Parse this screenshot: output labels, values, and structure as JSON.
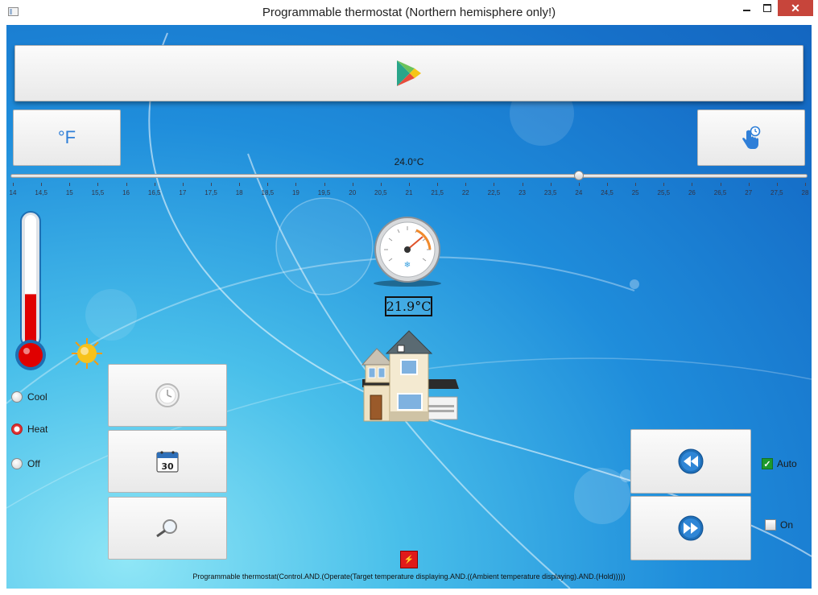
{
  "window": {
    "title": "Programmable thermostat (Northern hemisphere only!)",
    "close_glyph": "✕"
  },
  "toolbar": {
    "play_icon": "play-store-icon",
    "unit_label": "°F",
    "touch_icon": "touch-timer-icon"
  },
  "slider": {
    "value_label": "24.0°C",
    "value": 24.0,
    "min": 14,
    "max": 28,
    "tick_labels": [
      "14",
      "14,5",
      "15",
      "15,5",
      "16",
      "16,5",
      "17",
      "17,5",
      "18",
      "18,5",
      "19",
      "19,5",
      "20",
      "20,5",
      "21",
      "21,5",
      "22",
      "22,5",
      "23",
      "23,5",
      "24",
      "24,5",
      "25",
      "25,5",
      "26",
      "26,5",
      "27",
      "27,5",
      "28"
    ]
  },
  "thermometer": {
    "level": 0.4,
    "color": "#e00000"
  },
  "mode": {
    "options": [
      {
        "label": "Cool",
        "selected": false
      },
      {
        "label": "Heat",
        "selected": true
      },
      {
        "label": "Off",
        "selected": false
      }
    ]
  },
  "ambient": {
    "readout": "21.9°C"
  },
  "schedule_buttons": {
    "clock_icon": "clock-icon",
    "calendar_day": "30",
    "search_icon": "magnifier-icon"
  },
  "program": {
    "auto_label": "Auto",
    "auto_checked": true,
    "on_label": "On",
    "on_checked": false,
    "check_glyph": "✓"
  },
  "status": {
    "power_glyph": "⚡",
    "text": "Programmable thermostat(Control.AND.(Operate(Target temperature displaying.AND.((Ambient temperature displaying).AND.(Hold)))))"
  },
  "colors": {
    "accent": "#2f7fd8",
    "heat": "#e00000",
    "auto_check": "#1d9a2e"
  }
}
